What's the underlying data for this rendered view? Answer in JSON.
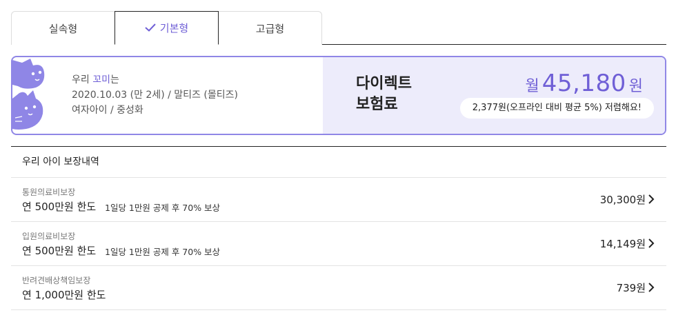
{
  "tabs": [
    {
      "label": "실속형",
      "selected": false
    },
    {
      "label": "기본형",
      "selected": true
    },
    {
      "label": "고급형",
      "selected": false
    }
  ],
  "pet": {
    "prefix": "우리 ",
    "name": "꼬미",
    "suffix": "는",
    "birth": "2020.10.03 (만 2세) / 말티즈 (몰티즈)",
    "gender": "여자아이 / 중성화"
  },
  "premium": {
    "title_line1": "다이렉트",
    "title_line2": "보험료",
    "unit_pre": "월",
    "amount": "45,180",
    "unit_post": "원",
    "discount_text": "2,377원(오프라인 대비 평균 5%) 저렴해요!"
  },
  "coverage": {
    "heading": "우리 아이 보장내역",
    "items": [
      {
        "category": "통원의료비보장",
        "limit": "연 500만원 한도",
        "desc": "1일당 1만원 공제 후 70% 보상",
        "price": "30,300원"
      },
      {
        "category": "입원의료비보장",
        "limit": "연 500만원 한도",
        "desc": "1일당 1만원 공제 후 70% 보상",
        "price": "14,149원"
      },
      {
        "category": "반려견배상책임보장",
        "limit": "연 1,000만원 한도",
        "desc": "",
        "price": "739원"
      }
    ]
  },
  "colors": {
    "accent": "#6f5fd6",
    "card_border": "#8f86e6",
    "premium_bg": "#edecfb"
  },
  "icons": {
    "selected_tab": "check-icon",
    "row_arrow": "chevron-right-icon",
    "illustration": "cat-illustration"
  }
}
